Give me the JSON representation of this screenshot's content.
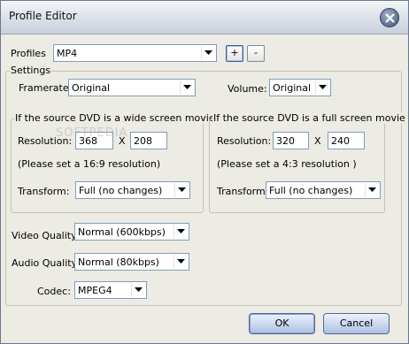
{
  "window": {
    "title": "Profile Editor"
  },
  "profiles": {
    "label": "Profiles",
    "value": "MP4",
    "add_label": "+",
    "remove_label": "-"
  },
  "settings": {
    "legend": "Settings",
    "framerate_label": "Framerate:",
    "framerate_value": "Original",
    "volume_label": "Volume:",
    "volume_value": "Original"
  },
  "wide": {
    "legend": "If the source DVD is a wide screen movie",
    "resolution_label": "Resolution:",
    "width": "368",
    "x_label": "X",
    "height": "208",
    "hint": "(Please set a 16:9 resolution)",
    "transform_label": "Transform:",
    "transform_value": "Full (no changes)"
  },
  "full": {
    "legend": "If the source DVD is a full screen movie",
    "resolution_label": "Resolution:",
    "width": "320",
    "x_label": "X",
    "height": "240",
    "hint": "(Please set a 4:3 resolution )",
    "transform_label": "Transform:",
    "transform_value": "Full (no changes)"
  },
  "video_quality": {
    "label": "Video Quality:",
    "value": "Normal (600kbps)"
  },
  "audio_quality": {
    "label": "Audio Quality:",
    "value": "Normal (80kbps)"
  },
  "codec": {
    "label": "Codec:",
    "value": "MPEG4"
  },
  "buttons": {
    "ok": "OK",
    "cancel": "Cancel"
  },
  "watermark": "SOFTPEDIA"
}
